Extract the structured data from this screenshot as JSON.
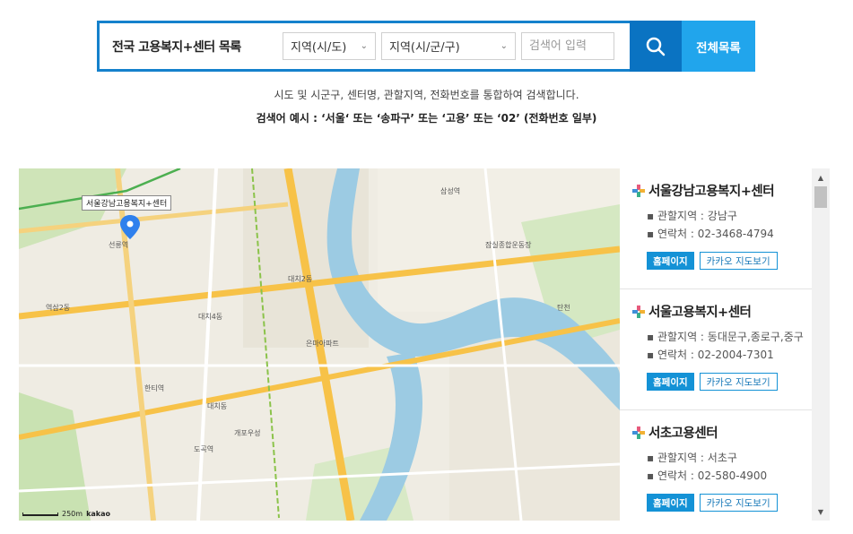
{
  "search": {
    "title": "전국 고용복지+센터 목록",
    "region_select": "지역(시/도)",
    "district_select": "지역(시/군/구)",
    "keyword_placeholder": "검색어 입력",
    "all_list_label": "전체목록"
  },
  "description": {
    "line1": "시도 및 시군구, 센터명, 관할지역, 전화번호를 통합하여 검색합니다.",
    "line2": "검색어 예시 : ‘서울‘ 또는 ‘송파구’ 또는 ‘고용’ 또는 ‘02’ (전화번호 일부)"
  },
  "map": {
    "marker_label": "서울강남고용복지+센터",
    "scale_text": "250m",
    "attribution": "kakao",
    "labels": [
      "선릉역",
      "대치4동",
      "대치동",
      "한티역",
      "도곡역",
      "삼성역",
      "잠실종합운동장",
      "탄천",
      "개포우성",
      "은마아파트",
      "대치2동",
      "역삼2동"
    ]
  },
  "centers": [
    {
      "name": "서울강남고용복지+센터",
      "area": "관할지역 : 강남구",
      "phone": "연락처 : 02-3468-4794",
      "home": "홈페이지",
      "kakao": "카카오 지도보기"
    },
    {
      "name": "서울고용복지+센터",
      "area": "관할지역 : 동대문구,종로구,중구",
      "phone": "연락처 : 02-2004-7301",
      "home": "홈페이지",
      "kakao": "카카오 지도보기"
    },
    {
      "name": "서초고용센터",
      "area": "관할지역 : 서초구",
      "phone": "연락처 : 02-580-4900",
      "home": "홈페이지",
      "kakao": "카카오 지도보기"
    }
  ],
  "colors": {
    "accent": "#1581cc",
    "search_button": "#0a73c2",
    "all_button": "#21a5ec",
    "river": "#9ccbe3",
    "road_major": "#f7c248"
  }
}
